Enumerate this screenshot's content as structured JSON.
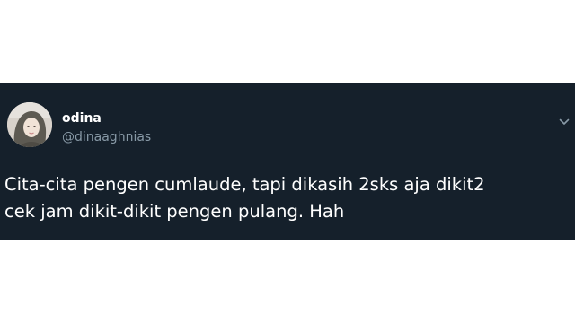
{
  "tweet": {
    "display_name": "odina",
    "handle": "@dinaaghnias",
    "text_lines": [
      "Cita-cita pengen cumlaude, tapi dikasih 2sks aja dikit2",
      "cek jam dikit-dikit pengen pulang. Hah"
    ],
    "icons": {
      "avatar": "profile-photo",
      "menu": "chevron-down-icon"
    }
  },
  "colors": {
    "card_background": "#15202b",
    "primary_text": "#ffffff",
    "secondary_text": "#8899a6",
    "page_background": "#ffffff"
  }
}
